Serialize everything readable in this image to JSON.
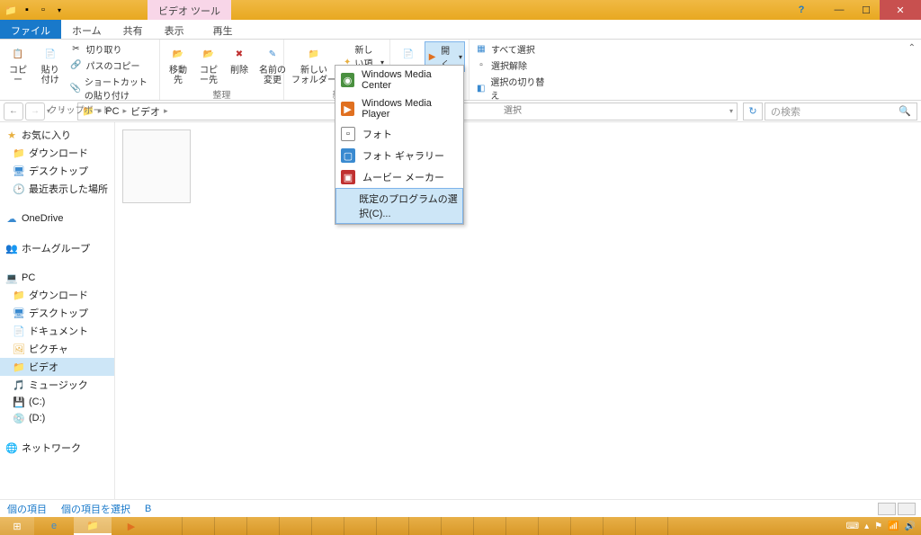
{
  "titlebar": {
    "tool_tab": "ビデオ ツール"
  },
  "tabs": {
    "file": "ファイル",
    "home": "ホーム",
    "share": "共有",
    "view": "表示",
    "playback": "再生"
  },
  "ribbon": {
    "clipboard": {
      "copy": "コピー",
      "paste": "貼り付け",
      "cut": "切り取り",
      "copy_path": "パスのコピー",
      "paste_shortcut": "ショートカットの貼り付け",
      "group": "クリップボード"
    },
    "organize": {
      "move_to": "移動先",
      "copy_to": "コピー先",
      "delete": "削除",
      "rename": "名前の\n変更",
      "group": "整理"
    },
    "new": {
      "new_folder": "新しい\nフォルダー",
      "new_item": "新しい項目",
      "group": "新"
    },
    "open": {
      "open": "開く"
    },
    "select": {
      "select_all": "すべて選択",
      "select_none": "選択解除",
      "invert": "選択の切り替え",
      "group": "選択"
    }
  },
  "open_with_menu": {
    "items": [
      "Windows Media Center",
      "Windows Media Player",
      "フォト",
      "フォト ギャラリー",
      "ムービー メーカー"
    ],
    "choose_default": "既定のプログラムの選択(C)..."
  },
  "navbar": {
    "pc": "PC",
    "videos": "ビデオ",
    "search_placeholder": "の検索"
  },
  "sidebar": {
    "favorites": "お気に入り",
    "downloads": "ダウンロード",
    "desktop": "デスクトップ",
    "recent": "最近表示した場所",
    "onedrive": "OneDrive",
    "homegroup": "ホームグループ",
    "pc": "PC",
    "pc_children": {
      "downloads": "ダウンロード",
      "desktop": "デスクトップ",
      "documents": "ドキュメント",
      "pictures": "ピクチャ",
      "videos": "ビデオ",
      "music": "ミュージック",
      "c_drive": "(C:)",
      "d_drive": "(D:)"
    },
    "network": "ネットワーク"
  },
  "statusbar": {
    "item_count": "個の項目",
    "selected": "個の項目を選択",
    "size_unit": "B"
  }
}
